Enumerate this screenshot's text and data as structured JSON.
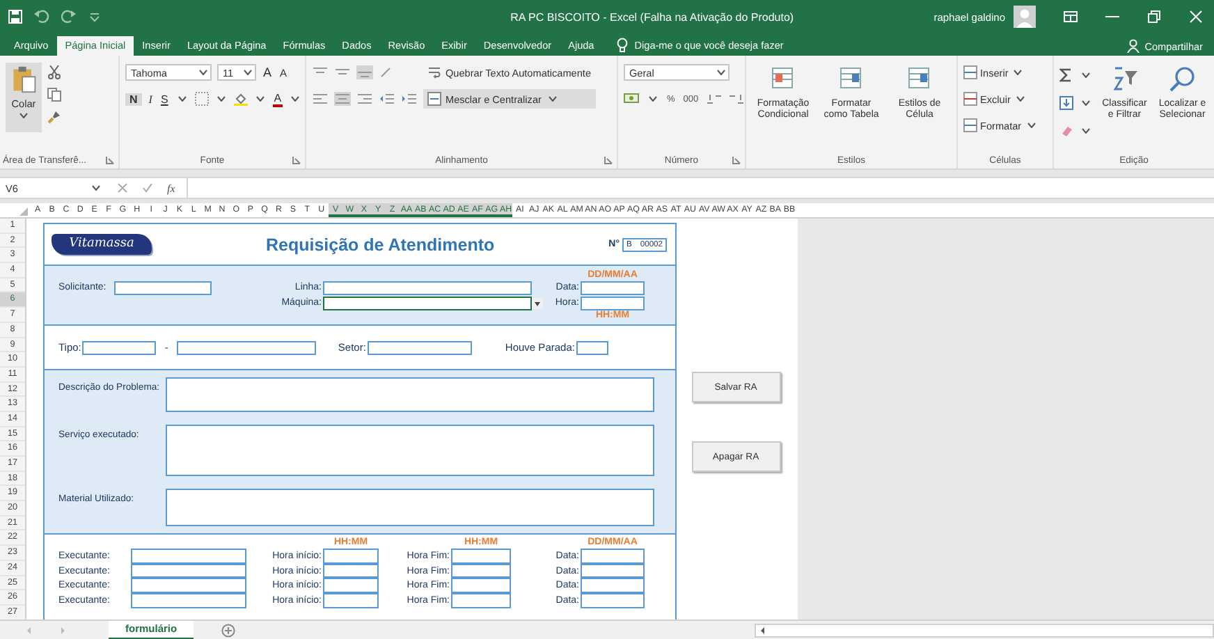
{
  "window": {
    "title": "RA PC BISCOITO  -  Excel (Falha na Ativação do Produto)",
    "user": "raphael galdino"
  },
  "ribbon_tabs": [
    {
      "label": "Arquivo",
      "selected": false
    },
    {
      "label": "Página Inicial",
      "selected": true
    },
    {
      "label": "Inserir",
      "selected": false
    },
    {
      "label": "Layout da Página",
      "selected": false
    },
    {
      "label": "Fórmulas",
      "selected": false
    },
    {
      "label": "Dados",
      "selected": false
    },
    {
      "label": "Revisão",
      "selected": false
    },
    {
      "label": "Exibir",
      "selected": false
    },
    {
      "label": "Desenvolvedor",
      "selected": false
    },
    {
      "label": "Ajuda",
      "selected": false
    }
  ],
  "tell_me": "Diga-me o que você deseja fazer",
  "share": "Compartilhar",
  "ribbon": {
    "clipboard": {
      "label": "Área de Transferê...",
      "paste": "Colar"
    },
    "font": {
      "label": "Fonte",
      "family": "Tahoma",
      "size": "11",
      "size_buttons": [
        "A",
        "A"
      ],
      "style_buttons": [
        "N",
        "I",
        "S"
      ],
      "color_button": "A"
    },
    "alignment": {
      "label": "Alinhamento",
      "wrap": "Quebrar Texto Automaticamente",
      "merge": "Mesclar e Centralizar"
    },
    "number": {
      "label": "Número",
      "format": "Geral",
      "percent": "%",
      "thousands": "000"
    },
    "styles": {
      "label": "Estilos",
      "buttons": [
        "Formatação Condicional",
        "Formatar como Tabela",
        "Estilos de Célula"
      ]
    },
    "cells": {
      "label": "Células",
      "buttons": [
        "Inserir",
        "Excluir",
        "Formatar"
      ]
    },
    "editing": {
      "label": "Edição",
      "buttons": [
        "Classificar e Filtrar",
        "Localizar e Selecionar"
      ]
    }
  },
  "formula_bar": {
    "name_box": "V6",
    "function_symbol": "fx"
  },
  "columns": [
    {
      "label": "A",
      "selected": false
    },
    {
      "label": "B",
      "selected": false
    },
    {
      "label": "C",
      "selected": false
    },
    {
      "label": "D",
      "selected": false
    },
    {
      "label": "E",
      "selected": false
    },
    {
      "label": "F",
      "selected": false
    },
    {
      "label": "G",
      "selected": false
    },
    {
      "label": "H",
      "selected": false
    },
    {
      "label": "I",
      "selected": false
    },
    {
      "label": "J",
      "selected": false
    },
    {
      "label": "K",
      "selected": false
    },
    {
      "label": "L",
      "selected": false
    },
    {
      "label": "M",
      "selected": false
    },
    {
      "label": "N",
      "selected": false
    },
    {
      "label": "O",
      "selected": false
    },
    {
      "label": "P",
      "selected": false
    },
    {
      "label": "Q",
      "selected": false
    },
    {
      "label": "R",
      "selected": false
    },
    {
      "label": "S",
      "selected": false
    },
    {
      "label": "T",
      "selected": false
    },
    {
      "label": "U",
      "selected": false
    },
    {
      "label": "V",
      "selected": true
    },
    {
      "label": "W",
      "selected": true
    },
    {
      "label": "X",
      "selected": true
    },
    {
      "label": "Y",
      "selected": true
    },
    {
      "label": "Z",
      "selected": true
    },
    {
      "label": "AA",
      "selected": true
    },
    {
      "label": "AB",
      "selected": true
    },
    {
      "label": "AC",
      "selected": true
    },
    {
      "label": "AD",
      "selected": true
    },
    {
      "label": "AE",
      "selected": true
    },
    {
      "label": "AF",
      "selected": true
    },
    {
      "label": "AG",
      "selected": true
    },
    {
      "label": "AH",
      "selected": true
    },
    {
      "label": "AI",
      "selected": false
    },
    {
      "label": "AJ",
      "selected": false
    },
    {
      "label": "AK",
      "selected": false
    },
    {
      "label": "AL",
      "selected": false
    },
    {
      "label": "AM",
      "selected": false
    },
    {
      "label": "AN",
      "selected": false
    },
    {
      "label": "AO",
      "selected": false
    },
    {
      "label": "AP",
      "selected": false
    },
    {
      "label": "AQ",
      "selected": false
    },
    {
      "label": "AR",
      "selected": false
    },
    {
      "label": "AS",
      "selected": false
    },
    {
      "label": "AT",
      "selected": false
    },
    {
      "label": "AU",
      "selected": false
    },
    {
      "label": "AV",
      "selected": false
    },
    {
      "label": "AW",
      "selected": false
    },
    {
      "label": "AX",
      "selected": false
    },
    {
      "label": "AY",
      "selected": false
    },
    {
      "label": "AZ",
      "selected": false
    },
    {
      "label": "BA",
      "selected": false
    },
    {
      "label": "BB",
      "selected": false
    }
  ],
  "rows": [
    {
      "label": "1",
      "selected": false
    },
    {
      "label": "2",
      "selected": false
    },
    {
      "label": "3",
      "selected": false
    },
    {
      "label": "4",
      "selected": false
    },
    {
      "label": "5",
      "selected": false
    },
    {
      "label": "6",
      "selected": true
    },
    {
      "label": "7",
      "selected": false
    },
    {
      "label": "8",
      "selected": false
    },
    {
      "label": "9",
      "selected": false
    },
    {
      "label": "10",
      "selected": false
    },
    {
      "label": "11",
      "selected": false
    },
    {
      "label": "12",
      "selected": false
    },
    {
      "label": "13",
      "selected": false
    },
    {
      "label": "14",
      "selected": false
    },
    {
      "label": "15",
      "selected": false
    },
    {
      "label": "16",
      "selected": false
    },
    {
      "label": "17",
      "selected": false
    },
    {
      "label": "18",
      "selected": false
    },
    {
      "label": "19",
      "selected": false
    },
    {
      "label": "20",
      "selected": false
    },
    {
      "label": "21",
      "selected": false
    },
    {
      "label": "22",
      "selected": false
    },
    {
      "label": "23",
      "selected": false
    },
    {
      "label": "24",
      "selected": false
    },
    {
      "label": "25",
      "selected": false
    },
    {
      "label": "26",
      "selected": false
    },
    {
      "label": "27",
      "selected": false
    }
  ],
  "form": {
    "logo": "Vitamassa",
    "title": "Requisição de Atendimento",
    "number_label": "N°",
    "number_series": "B",
    "number_value": "00002",
    "date_hint": "DD/MM/AA",
    "time_hint": "HH:MM",
    "requester_label": "Solicitante:",
    "line_label": "Linha:",
    "machine_label": "Máquina:",
    "machine_field": {
      "active": true
    },
    "date_label": "Data:",
    "time_label": "Hora:",
    "type_label": "Tipo:",
    "type_separator": "-",
    "sector_label": "Setor:",
    "stop_label": "Houve Parada:",
    "text_fields": [
      {
        "label": "Descrição do Problema:"
      },
      {
        "label": "Serviço executado:"
      },
      {
        "label": "Material Utilizado:"
      }
    ],
    "work_hints": [
      "HH:MM",
      "HH:MM",
      "DD/MM/AA"
    ],
    "work_rows": [
      {
        "executor": "Executante:",
        "start": "Hora início:",
        "end": "Hora Fim:",
        "date": "Data:"
      },
      {
        "executor": "Executante:",
        "start": "Hora início:",
        "end": "Hora Fim:",
        "date": "Data:"
      },
      {
        "executor": "Executante:",
        "start": "Hora início:",
        "end": "Hora Fim:",
        "date": "Data:"
      },
      {
        "executor": "Executante:",
        "start": "Hora início:",
        "end": "Hora Fim:",
        "date": "Data:"
      }
    ]
  },
  "buttons": [
    "Salvar RA",
    "Apagar RA"
  ],
  "sheet_tabs": [
    {
      "label": "formulário",
      "selected": true
    }
  ]
}
